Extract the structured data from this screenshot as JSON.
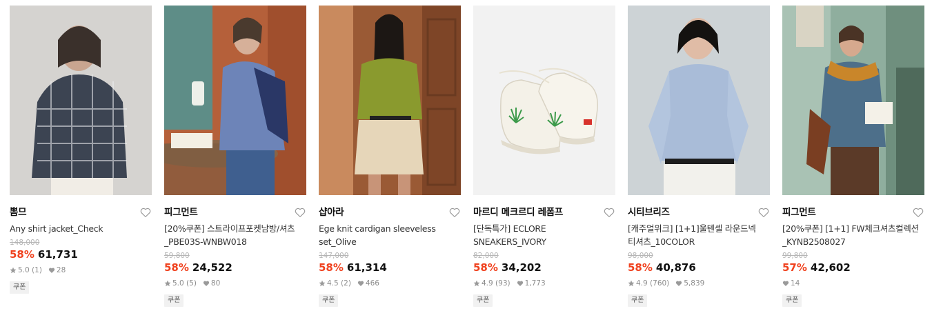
{
  "products": [
    {
      "brand": "뽐므",
      "title": "Any shirt jacket_Check",
      "original_price": "148,000",
      "discount": "58%",
      "price": "61,731",
      "rating": "5.0",
      "review_count": "(1)",
      "likes": "28",
      "badge": "쿠폰"
    },
    {
      "brand": "피그먼트",
      "title": "[20%쿠폰] 스트라이프포켓남방/셔츠_PBE03S-WNBW018",
      "original_price": "59,800",
      "discount": "58%",
      "price": "24,522",
      "rating": "5.0",
      "review_count": "(5)",
      "likes": "80",
      "badge": "쿠폰"
    },
    {
      "brand": "샵아라",
      "title": "Ege knit cardigan sleeveless set_Olive",
      "original_price": "147,000",
      "discount": "58%",
      "price": "61,314",
      "rating": "4.5",
      "review_count": "(2)",
      "likes": "466",
      "badge": "쿠폰"
    },
    {
      "brand": "마르디 메크르디 레폼프",
      "title": "[단독특가] ECLORE SNEAKERS_IVORY",
      "original_price": "82,000",
      "discount": "58%",
      "price": "34,202",
      "rating": "4.9",
      "review_count": "(93)",
      "likes": "1,773",
      "badge": "쿠폰"
    },
    {
      "brand": "시티브리즈",
      "title": "[캐주얼위크] [1+1]울텐셀 라운드넥 티셔츠_10COLOR",
      "original_price": "98,000",
      "discount": "58%",
      "price": "40,876",
      "rating": "4.9",
      "review_count": "(760)",
      "likes": "5,839",
      "badge": "쿠폰"
    },
    {
      "brand": "피그먼트",
      "title": "[20%쿠폰] [1+1] FW체크셔츠컬렉션_KYNB2508027",
      "original_price": "99,800",
      "discount": "57%",
      "price": "42,602",
      "likes": "14",
      "badge": "쿠폰"
    }
  ],
  "colors": {
    "discount": "#f0411e",
    "price": "#111111",
    "strike": "#b5b5b5",
    "meta": "#8c8c8c",
    "badge_bg": "#f1f1f1"
  },
  "icons": {
    "wishlist": "heart-outline-icon",
    "rating": "star-icon",
    "likes": "heart-filled-icon"
  }
}
